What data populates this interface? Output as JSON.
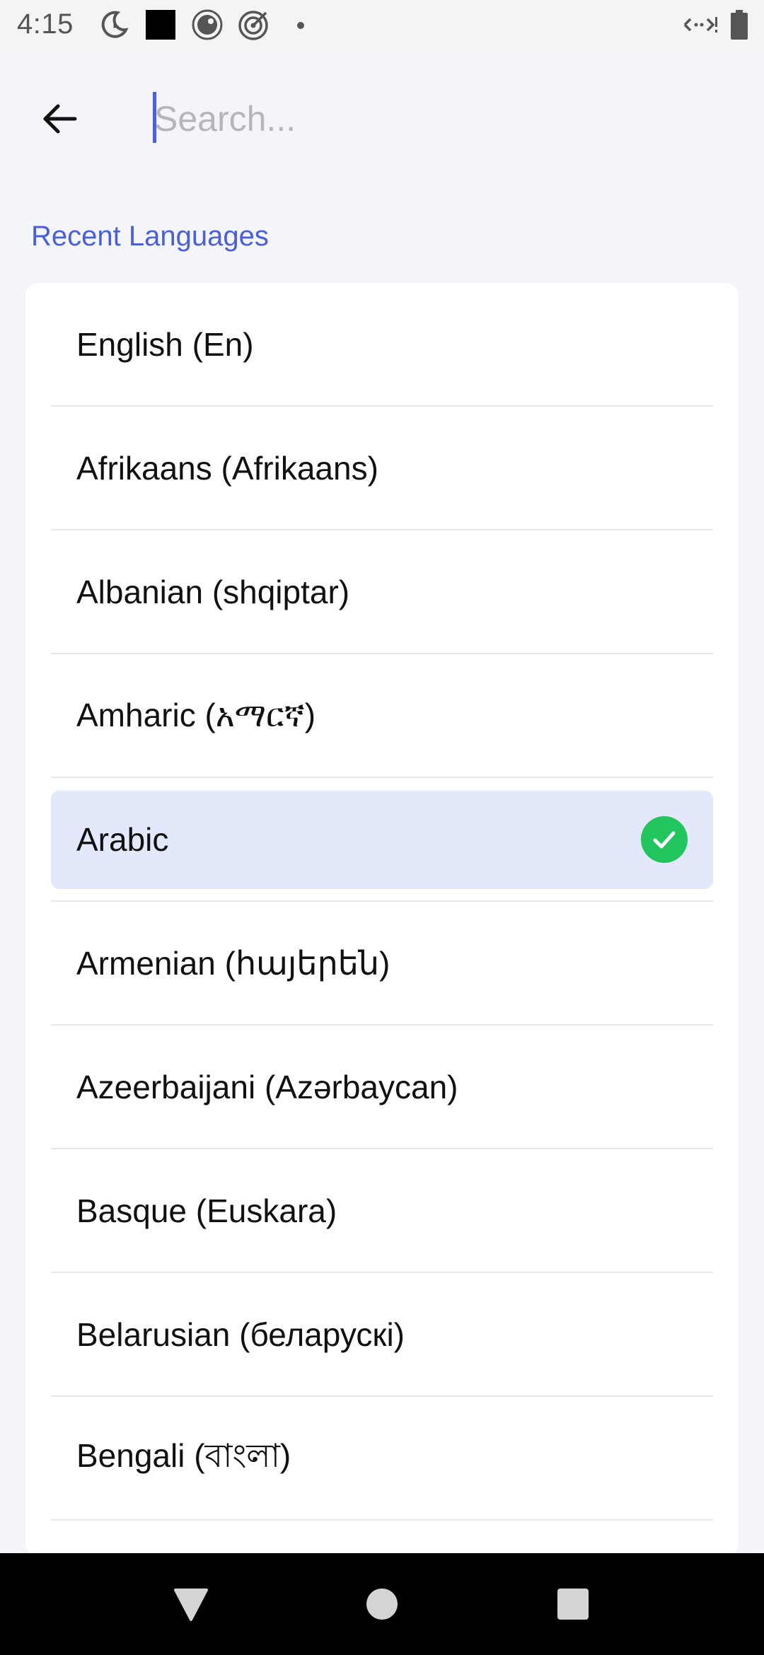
{
  "status_bar": {
    "time": "4:15",
    "icons": [
      "do-not-disturb-icon",
      "square-app-icon",
      "record-icon",
      "target-icon",
      "more-dot-icon",
      "data-saver-icon",
      "battery-icon"
    ]
  },
  "header": {
    "search_placeholder": "Search...",
    "search_value": ""
  },
  "section": {
    "title": "Recent Languages"
  },
  "languages": [
    {
      "label": "English (En)",
      "selected": false
    },
    {
      "label": "Afrikaans (Afrikaans)",
      "selected": false
    },
    {
      "label": "Albanian (shqiptar)",
      "selected": false
    },
    {
      "label": "Amharic (አማርኛ)",
      "selected": false
    },
    {
      "label": "Arabic",
      "selected": true
    },
    {
      "label": "Armenian (հայերեն)",
      "selected": false
    },
    {
      "label": "Azeerbaijani (Azərbaycan)",
      "selected": false
    },
    {
      "label": "Basque (Euskara)",
      "selected": false
    },
    {
      "label": "Belarusian (беларускі)",
      "selected": false
    },
    {
      "label": "Bengali (বাংলা)",
      "selected": false
    }
  ],
  "colors": {
    "accent": "#4a5fd8",
    "selected_bg": "#e3e8fb",
    "check": "#22c55e"
  }
}
